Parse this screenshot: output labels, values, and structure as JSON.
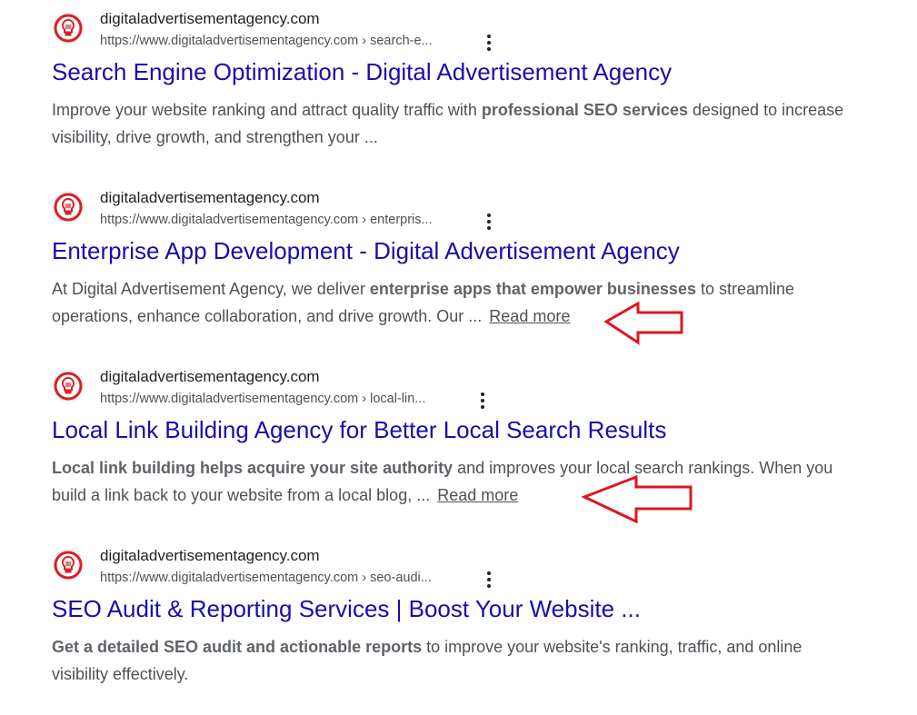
{
  "results": [
    {
      "site_name": "digitaladvertisementagency.com",
      "url": "https://www.digitaladvertisementagency.com › search-e...",
      "title": "Search Engine Optimization - Digital Advertisement Agency",
      "snippet": {
        "before": "Improve your website ranking and attract quality traffic with ",
        "bold": "professional SEO services",
        "after": " designed to increase visibility, drive growth, and strengthen your ..."
      },
      "read_more": ""
    },
    {
      "site_name": "digitaladvertisementagency.com",
      "url": "https://www.digitaladvertisementagency.com › enterpris...",
      "title": "Enterprise App Development - Digital Advertisement Agency",
      "snippet": {
        "before": "At Digital Advertisement Agency, we deliver ",
        "bold": "enterprise apps that empower businesses",
        "after": " to streamline operations, enhance collaboration, and drive growth. Our ..."
      },
      "read_more": "Read more"
    },
    {
      "site_name": "digitaladvertisementagency.com",
      "url": "https://www.digitaladvertisementagency.com › local-lin...",
      "title": "Local Link Building Agency for Better Local Search Results",
      "snippet": {
        "before": "",
        "bold": "Local link building helps acquire your site authority",
        "after": " and improves your local search rankings. When you build a link back to your website from a local blog, ..."
      },
      "read_more": "Read more"
    },
    {
      "site_name": "digitaladvertisementagency.com",
      "url": "https://www.digitaladvertisementagency.com › seo-audi...",
      "title": "SEO Audit & Reporting Services | Boost Your Website ...",
      "snippet": {
        "before": "",
        "bold": "Get a detailed SEO audit and actionable reports",
        "after": " to improve your website's ranking, traffic, and online visibility effectively."
      },
      "read_more": ""
    }
  ],
  "icons": {
    "favicon": "lightbulb-logo-icon",
    "more": "more-vert-icon",
    "annotation": "red-arrow-icon"
  },
  "colors": {
    "title_link": "#1a0dab",
    "snippet_text": "#4d5156",
    "favicon_red": "#d81f26",
    "annotation_arrow": "#e0141e"
  }
}
